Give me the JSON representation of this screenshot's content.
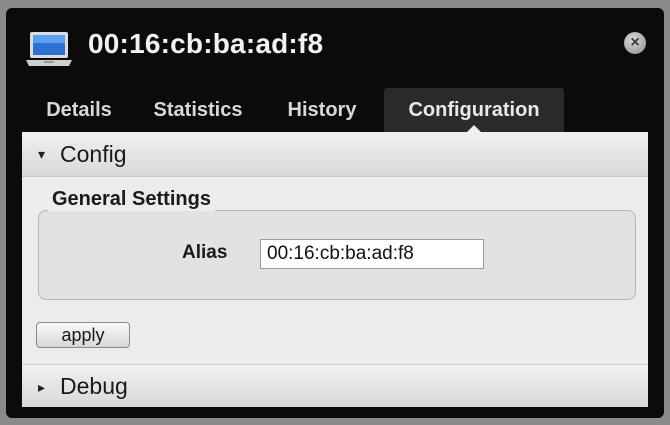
{
  "window": {
    "title": "00:16:cb:ba:ad:f8",
    "icon": "laptop-icon",
    "close_icon": "close-icon"
  },
  "tabs": [
    {
      "label": "Details",
      "selected": false
    },
    {
      "label": "Statistics",
      "selected": false
    },
    {
      "label": "History",
      "selected": false
    },
    {
      "label": "Configuration",
      "selected": true
    }
  ],
  "config_section": {
    "title": "Config",
    "expanded": true,
    "arrow": "▾",
    "general_settings": {
      "legend": "General Settings",
      "alias_label": "Alias",
      "alias_value": "00:16:cb:ba:ad:f8"
    },
    "apply_label": "apply"
  },
  "debug_section": {
    "title": "Debug",
    "expanded": false,
    "arrow": "▸"
  },
  "colors": {
    "window_bg": "#0b0b0b",
    "panel_bg": "#ececec",
    "selected_tab": "#2a2a2a"
  }
}
